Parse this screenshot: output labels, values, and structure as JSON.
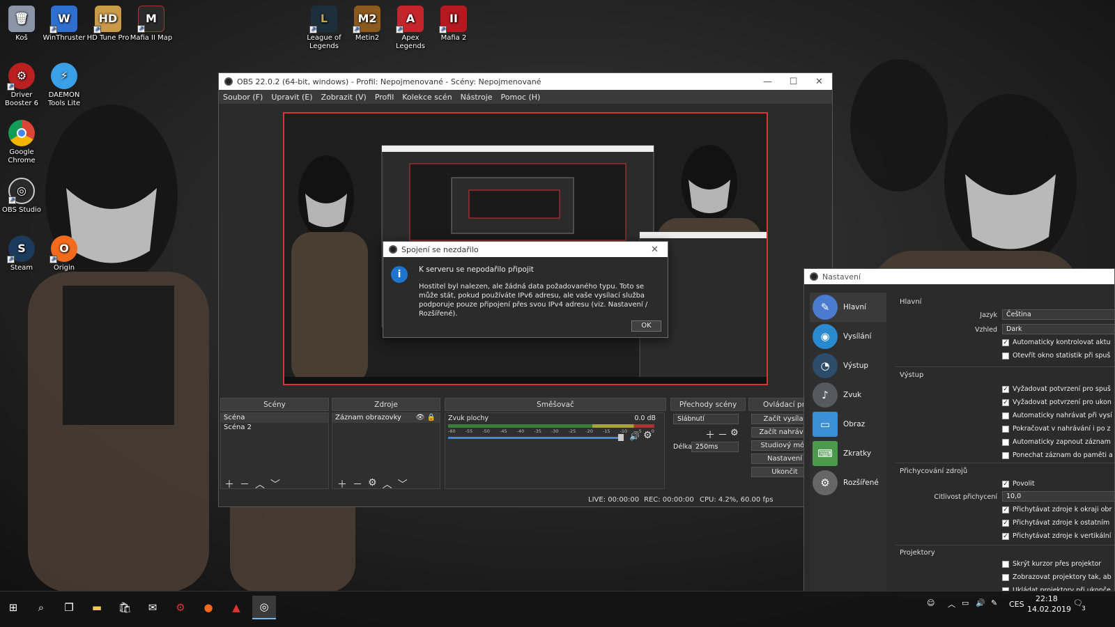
{
  "desktop": {
    "icons": [
      {
        "label": "Koš"
      },
      {
        "label": "WinThruster"
      },
      {
        "label": "HD Tune Pro"
      },
      {
        "label": "Mafia II Map"
      },
      {
        "label": "League of Legends"
      },
      {
        "label": "Metin2"
      },
      {
        "label": "Apex Legends"
      },
      {
        "label": "Mafia 2"
      },
      {
        "label": "Driver Booster 6"
      },
      {
        "label": "DAEMON Tools Lite"
      },
      {
        "label": "Google Chrome"
      },
      {
        "label": "OBS Studio"
      },
      {
        "label": "Steam"
      },
      {
        "label": "Origin"
      }
    ]
  },
  "obs": {
    "title": "OBS 22.0.2 (64-bit, windows) - Profil: Nepojmenované - Scény: Nepojmenované",
    "menu": [
      "Soubor (F)",
      "Upravit (E)",
      "Zobrazit (V)",
      "Profil",
      "Kolekce scén",
      "Nástroje",
      "Pomoc (H)"
    ],
    "docks": {
      "scenes": {
        "title": "Scény",
        "items": [
          "Scéna",
          "Scéna 2"
        ]
      },
      "sources": {
        "title": "Zdroje",
        "items": [
          "Záznam obrazovky"
        ]
      },
      "mixer": {
        "title": "Směšovač",
        "channel": "Zvuk plochy",
        "db": "0.0 dB",
        "scale": [
          "-60",
          "-55",
          "-50",
          "-45",
          "-40",
          "-35",
          "-30",
          "-25",
          "-20",
          "-15",
          "-10",
          "-5",
          "0"
        ]
      },
      "transitions": {
        "title": "Přechody scény",
        "type": "Slábnutí",
        "duration_label": "Délka",
        "duration": "250ms"
      },
      "controls": {
        "title": "Ovládací prvky",
        "buttons": [
          "Začít vysílat",
          "Začít nahrávat",
          "Studiový mód",
          "Nastavení",
          "Ukončit"
        ]
      }
    },
    "status": {
      "live": "LIVE: 00:00:00",
      "rec": "REC: 00:00:00",
      "cpu": "CPU: 4.2%, 60.00 fps"
    }
  },
  "dialog": {
    "title": "Spojení se nezdařilo",
    "heading": "K serveru se nepodařilo připojit",
    "body": "Hostitel byl nalezen, ale žádná data požadovaného typu. Toto se může stát, pokud používáte IPv6 adresu, ale vaše vysílací služba podporuje pouze připojení přes svou IPv4 adresu (viz. Nastavení / Rozšířené).",
    "ok": "OK"
  },
  "settings": {
    "title": "Nastavení",
    "nav": [
      {
        "label": "Hlavní",
        "color": "#4a7bd0"
      },
      {
        "label": "Vysílání",
        "color": "#2a8ad0"
      },
      {
        "label": "Výstup",
        "color": "#2c4c6a"
      },
      {
        "label": "Zvuk",
        "color": "#555a60"
      },
      {
        "label": "Obraz",
        "color": "#3b8fd6"
      },
      {
        "label": "Zkratky",
        "color": "#4c9a4c"
      },
      {
        "label": "Rozšířené",
        "color": "#666"
      }
    ],
    "general": {
      "title": "Hlavní",
      "language_label": "Jazyk",
      "language": "Čeština",
      "theme_label": "Vzhled",
      "theme": "Dark",
      "checks": [
        {
          "label": "Automaticky kontrolovat aktu",
          "checked": true
        },
        {
          "label": "Otevřít okno statistik při spuš",
          "checked": false
        }
      ]
    },
    "output": {
      "title": "Výstup",
      "checks": [
        {
          "label": "Vyžadovat potvrzení pro spuš",
          "checked": true
        },
        {
          "label": "Vyžadovat potvrzení pro ukon",
          "checked": true
        },
        {
          "label": "Automaticky nahrávat při vysí",
          "checked": false
        },
        {
          "label": "Pokračovat v nahrávání i po z",
          "checked": false
        },
        {
          "label": "Automaticky zapnout záznam",
          "checked": false
        },
        {
          "label": "Ponechat záznam do paměti a",
          "checked": false
        }
      ]
    },
    "snapping": {
      "title": "Přichycování zdrojů",
      "enable": {
        "label": "Povolit",
        "checked": true
      },
      "sensitivity_label": "Citlivost přichycení",
      "sensitivity": "10,0",
      "checks": [
        {
          "label": "Přichytávat zdroje k okraji obr",
          "checked": true
        },
        {
          "label": "Přichytávat zdroje k ostatním",
          "checked": true
        },
        {
          "label": "Přichytávat zdroje k vertikální",
          "checked": true
        }
      ]
    },
    "projectors": {
      "title": "Projektory",
      "checks": [
        {
          "label": "Skrýt kurzor přes projektor",
          "checked": false
        },
        {
          "label": "Zobrazovat projektory tak, ab",
          "checked": false
        },
        {
          "label": "Ukládat projektory při ukonče",
          "checked": false
        }
      ]
    }
  },
  "taskbar": {
    "lang": "CES",
    "time": "22:18",
    "date": "14.02.2019",
    "notifications": "3"
  }
}
